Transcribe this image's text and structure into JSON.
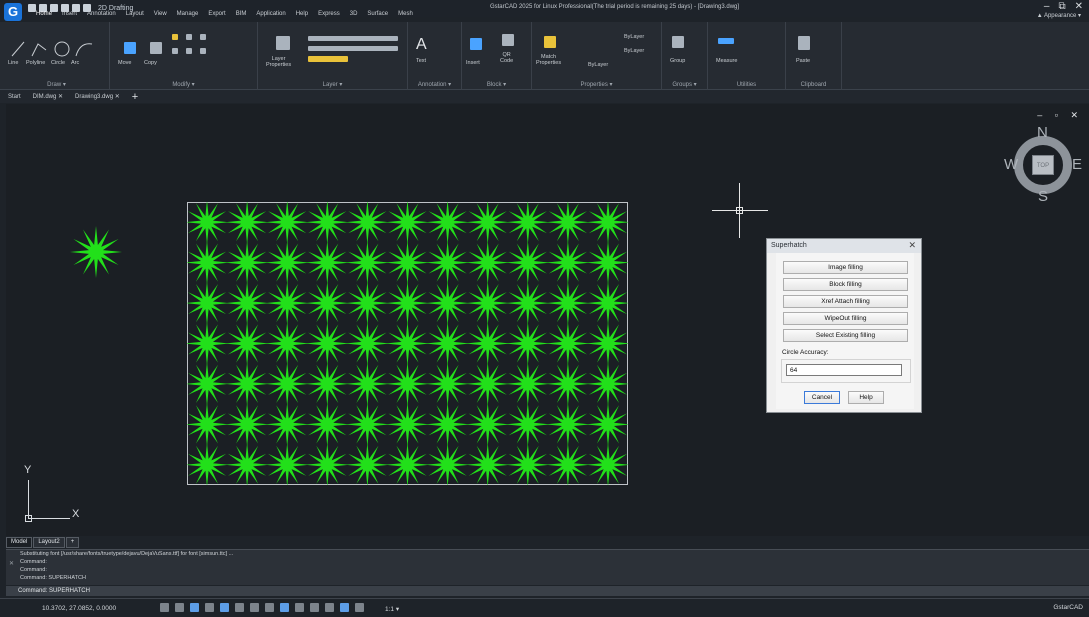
{
  "window": {
    "title": "GstarCAD 2025 for Linux Professional(The trial period is remaining 25 days) - [Drawing3.dwg]",
    "workspace": "2D Drafting",
    "controls": [
      "–",
      "⧉",
      "✕"
    ]
  },
  "ribbon_tabs": [
    "Home",
    "Insert",
    "Annotation",
    "Layout",
    "View",
    "Manage",
    "Export",
    "BIM",
    "Application",
    "Help",
    "Express",
    "3D",
    "Surface",
    "Mesh"
  ],
  "appearance_label": "▲ Appearance ▾",
  "ribbon": {
    "draw": {
      "tools": [
        "Line",
        "Polyline",
        "Circle",
        "Arc"
      ],
      "label": "Draw ▾"
    },
    "modify": {
      "tools": [
        "Move",
        "Copy"
      ],
      "label": "Modify ▾"
    },
    "layer": {
      "tool": "Layer\nProperties",
      "label": "Layer ▾"
    },
    "annotation": {
      "tool": "Text",
      "label": "Annotation ▾"
    },
    "block": {
      "tools": [
        "Insert",
        "QR\nCode"
      ],
      "label": "Block ▾"
    },
    "properties": {
      "match": "Match\nProperties",
      "bylayer1": "ByLayer",
      "bylayer2": "ByLayer",
      "bylayer3": "ByLayer",
      "label": "Properties ▾"
    },
    "groups": {
      "tool": "Group",
      "label": "Groups ▾"
    },
    "utilities": {
      "tool": "Measure",
      "label": "Utilities"
    },
    "clipboard": {
      "tool": "Paste",
      "label": "Clipboard"
    }
  },
  "doc_tabs": [
    "Start",
    "DIM.dwg ✕",
    "Drawing3.dwg ✕"
  ],
  "canvas": {
    "controls": "– ▫ ✕",
    "ucs": {
      "y": "Y",
      "x": "X"
    },
    "viewcube": {
      "n": "N",
      "s": "S",
      "e": "E",
      "w": "W",
      "top": "TOP"
    },
    "hatch": {
      "rows": 7,
      "cols": 11,
      "color": "#22e01a"
    }
  },
  "dialog": {
    "title": "Superhatch",
    "buttons": [
      "Image filling",
      "Block filling",
      "Xref Attach filling",
      "WipeOut filling",
      "Select Existing filling"
    ],
    "accuracy_label": "Circle Accuracy:",
    "accuracy_value": "64",
    "cancel": "Cancel",
    "help": "Help"
  },
  "layout_tabs": [
    "Model",
    "Layout2",
    "+"
  ],
  "command": {
    "lines": [
      "Substituting font [/usr/share/fonts/truetype/dejavu/DejaVuSans.ttf] for font [simsun.ttc] ...",
      "Command:",
      "Command:",
      "Command: SUPERHATCH"
    ],
    "input": "Command: SUPERHATCH"
  },
  "status": {
    "coords": "10.3702, 27.0852, 0.0000",
    "scale": "1:1 ▾",
    "brand": "GstarCAD"
  }
}
